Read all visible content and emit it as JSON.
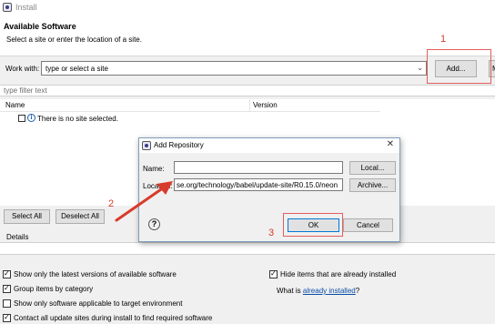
{
  "window": {
    "title": "Install"
  },
  "header": {
    "title": "Available Software",
    "subtitle": "Select a site or enter the location of a site."
  },
  "work_with": {
    "label": "Work with:",
    "value": "type or select a site",
    "add_button": "Add...",
    "manage_button_partial": "M"
  },
  "filter": {
    "placeholder": "type filter text"
  },
  "table": {
    "columns": [
      "Name",
      "Version"
    ],
    "rows": [
      {
        "text": "There is no site selected."
      }
    ]
  },
  "buttons": {
    "select_all": "Select All",
    "deselect_all": "Deselect All"
  },
  "details": {
    "label": "Details"
  },
  "options": [
    {
      "label": "Show only the latest versions of available software",
      "checked": true
    },
    {
      "label": "Group items by category",
      "checked": true
    },
    {
      "label": "Show only software applicable to target environment",
      "checked": false
    },
    {
      "label": "Contact all update sites during install to find required software",
      "checked": true
    },
    {
      "label": "Hide items that are already installed",
      "checked": true
    }
  ],
  "what_is": {
    "prefix": "What is ",
    "link": "already installed",
    "suffix": "?"
  },
  "dialog": {
    "title": "Add Repository",
    "name_label": "Name:",
    "name_value": "",
    "local_button": "Local...",
    "location_label": "Location:",
    "location_value": "se.org/technology/babel/update-site/R0.15.0/neon",
    "archive_button": "Archive...",
    "ok_button": "OK",
    "cancel_button": "Cancel",
    "help_icon": "?"
  },
  "annotations": {
    "one": "1",
    "two": "2",
    "three": "3"
  },
  "colors": {
    "annotation_red": "#d83b2b",
    "link_blue": "#0a4ea8"
  }
}
